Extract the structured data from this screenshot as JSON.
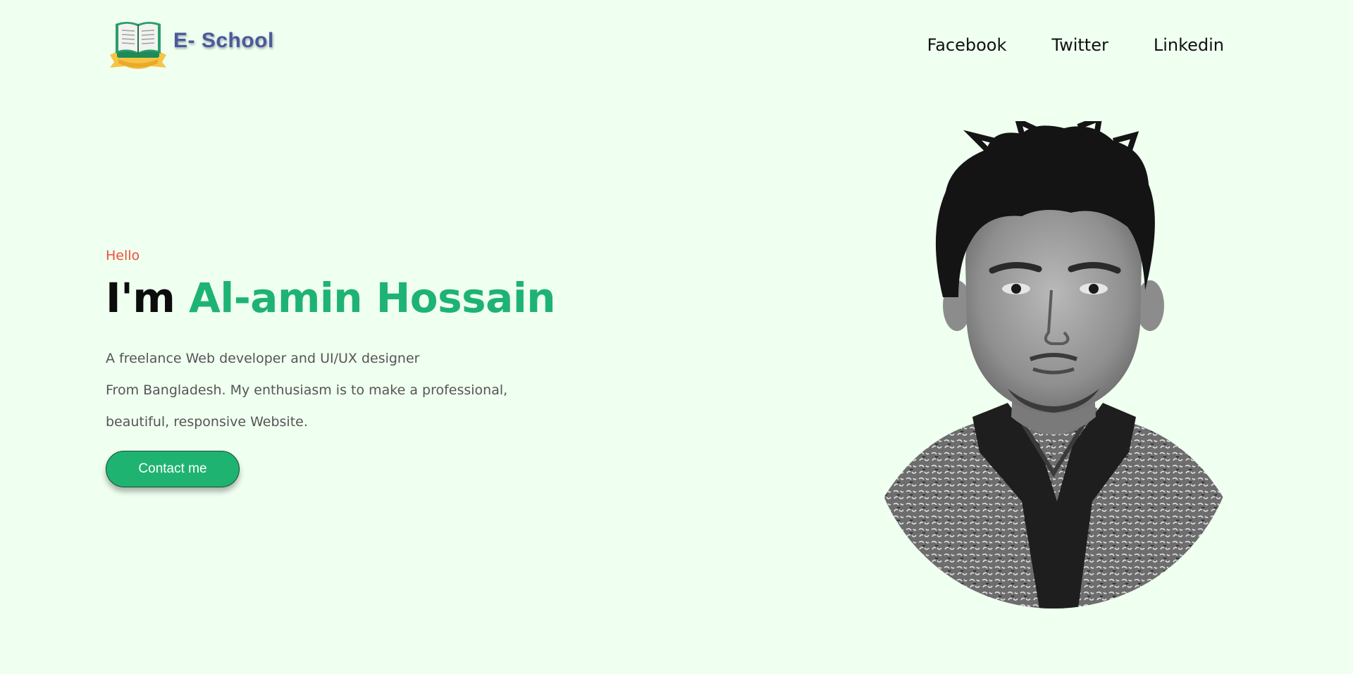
{
  "header": {
    "logo_text": "E- School",
    "logo_icon": "open-book-icon",
    "nav": [
      {
        "label": "Facebook"
      },
      {
        "label": "Twitter"
      },
      {
        "label": "Linkedin"
      }
    ]
  },
  "hero": {
    "greeting": "Hello",
    "headline_prefix": "I'm ",
    "headline_name": "Al-amin Hossain",
    "description_lines": [
      "A freelance Web developer and UI/UX designer",
      "From Bangladesh. My enthusiasm is to make a professional,",
      "beautiful, responsive Website."
    ],
    "contact_button": "Contact me"
  },
  "colors": {
    "background": "#effff0",
    "accent_green": "#1eb374",
    "greeting_red": "#ef4e36",
    "logo_text": "#4a5a9a"
  }
}
